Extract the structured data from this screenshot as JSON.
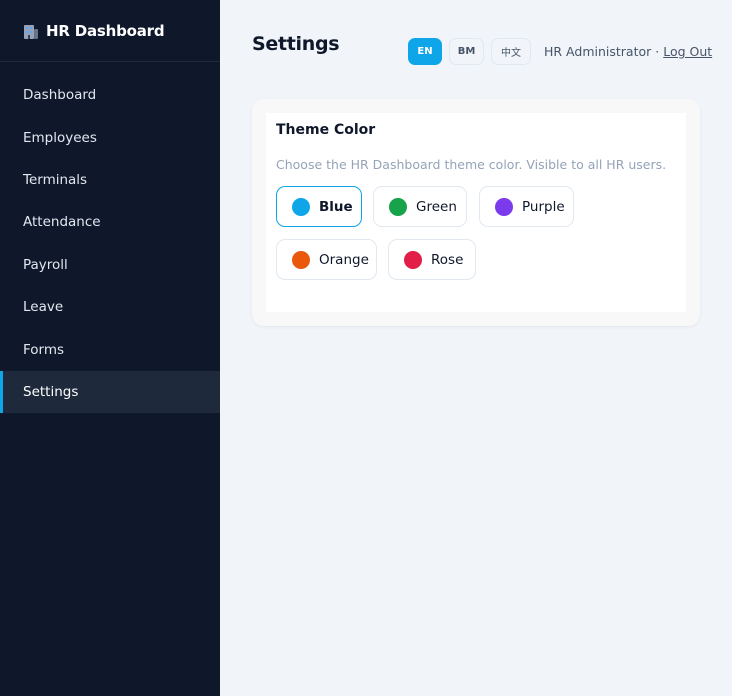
{
  "sidebar": {
    "brand": "HR Dashboard",
    "items": [
      {
        "label": "Dashboard"
      },
      {
        "label": "Employees"
      },
      {
        "label": "Terminals"
      },
      {
        "label": "Attendance"
      },
      {
        "label": "Payroll"
      },
      {
        "label": "Leave"
      },
      {
        "label": "Forms"
      },
      {
        "label": "Settings",
        "active": true
      }
    ]
  },
  "header": {
    "title": "Settings",
    "languages": [
      {
        "label": "EN",
        "active": true
      },
      {
        "label": "BM"
      },
      {
        "label": "中文"
      }
    ],
    "user": "HR Administrator",
    "separator": " · ",
    "logout": "Log Out"
  },
  "theme_card": {
    "title": "Theme Color",
    "description": "Choose the HR Dashboard theme color. Visible to all HR users.",
    "options": [
      {
        "label": "Blue",
        "color": "#0ea5e9",
        "selected": true
      },
      {
        "label": "Green",
        "color": "#16a34a"
      },
      {
        "label": "Purple",
        "color": "#7c3aed"
      },
      {
        "label": "Orange",
        "color": "#ea580c"
      },
      {
        "label": "Rose",
        "color": "#e11d48"
      }
    ]
  },
  "colors": {
    "sidebar_bg": "#0f172a",
    "accent": "#0ea5e9",
    "page_bg": "#f1f4f9"
  }
}
